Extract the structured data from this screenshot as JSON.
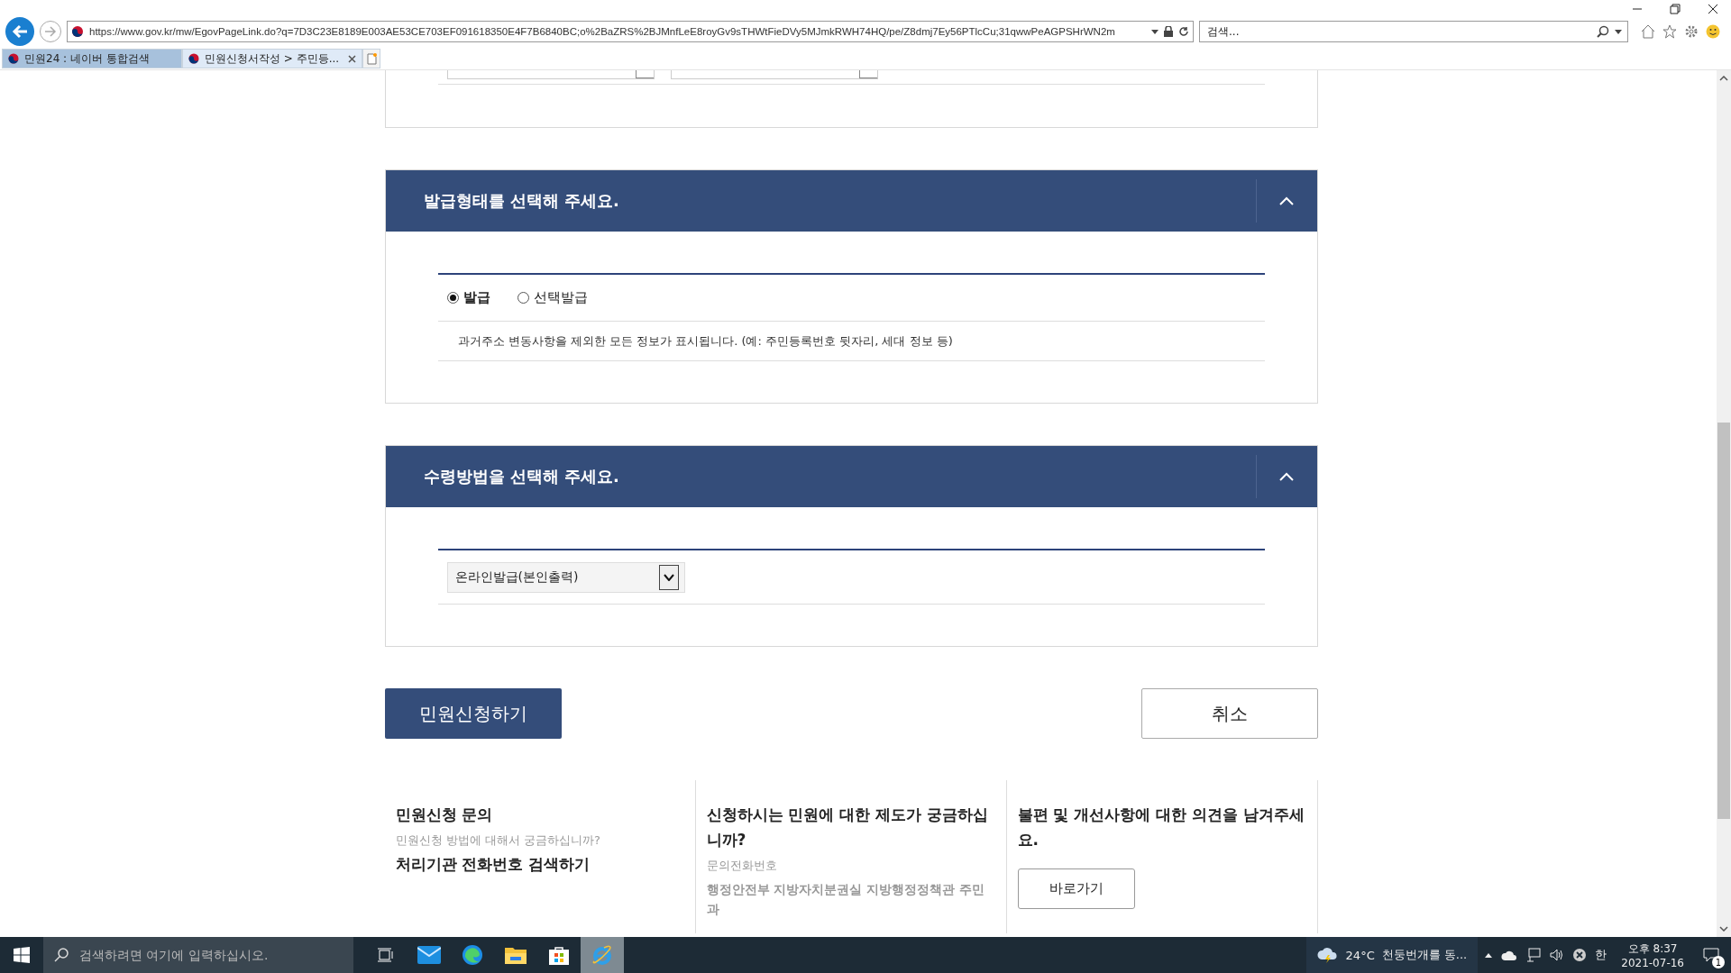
{
  "browser": {
    "url": "https://www.gov.kr/mw/EgovPageLink.do?q=7D3C23E8189E003AE53CE703EF091618350E4F7B6840BC;o%2BaZRS%2BJMnfLeE8royGv9sTHWtFieDVy5MJmkRWH74HQ/pe/Z8dmj7Ey56PTlcCu;31qwwPeAGPSHrWN2m",
    "search_placeholder": "검색...",
    "tabs": [
      {
        "label": "민원24 : 네이버 통합검색",
        "selected": false
      },
      {
        "label": "민원신청서작성 > 주민등...",
        "selected": true
      }
    ]
  },
  "sections": [
    {
      "title": "발급형태를 선택해 주세요.",
      "expanded": true,
      "kind": "radio",
      "options": [
        {
          "label": "발급",
          "selected": true
        },
        {
          "label": "선택발급",
          "selected": false
        }
      ],
      "note": "과거주소 변동사항을 제외한 모든 정보가 표시됩니다. (예: 주민등록번호 뒷자리, 세대 정보 등)"
    },
    {
      "title": "수령방법을 선택해 주세요.",
      "expanded": true,
      "kind": "select",
      "value": "온라인발급(본인출력)"
    }
  ],
  "actions": {
    "submit": "민원신청하기",
    "cancel": "취소"
  },
  "footer": [
    {
      "title": "민원신청 문의",
      "sub": "민원신청 방법에 대해서 궁금하십니까?",
      "link": "처리기관 전화번호 검색하기"
    },
    {
      "title": "신청하시는 민원에 대한 제도가 궁금하십니까?",
      "sub": "문의전화번호",
      "detail": "행정안전부 지방자치분권실 지방행정정책관 주민과"
    },
    {
      "title": "불편 및 개선사항에 대한 의견을 남겨주세요.",
      "button": "바로가기"
    }
  ],
  "taskbar": {
    "search_placeholder": "검색하려면 여기에 입력하십시오.",
    "weather": "24°C",
    "weather_text": "천둥번개를 동...",
    "ime": "한",
    "time": "오후 8:37",
    "date": "2021-07-16",
    "notifications": "1"
  }
}
